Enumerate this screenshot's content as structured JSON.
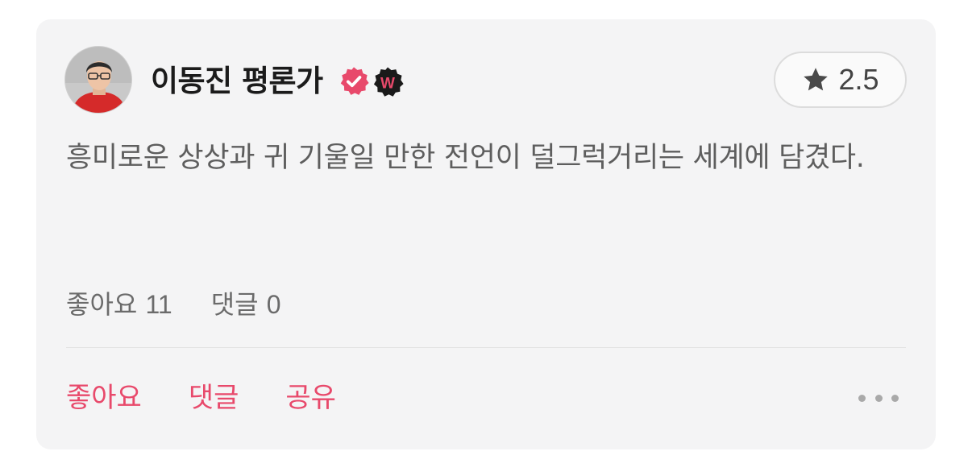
{
  "review": {
    "author": {
      "name": "이동진 평론가",
      "verified_icon": "verified-check-badge-icon",
      "badge_icon": "watcha-w-badge-icon",
      "badge_letter": "W"
    },
    "rating": {
      "icon": "star-icon",
      "value": "2.5"
    },
    "text": "흥미로운 상상과 귀 기울일 만한 전언이 덜그럭거리는 세계에 담겼다.",
    "stats": {
      "likes_label": "좋아요",
      "likes_count": "11",
      "comments_label": "댓글",
      "comments_count": "0"
    },
    "actions": {
      "like": "좋아요",
      "comment": "댓글",
      "share": "공유",
      "more_icon": "more-horizontal-icon"
    }
  },
  "colors": {
    "accent": "#e8496b",
    "card_background": "#f4f4f5",
    "badge_dark": "#1a1a1a"
  }
}
